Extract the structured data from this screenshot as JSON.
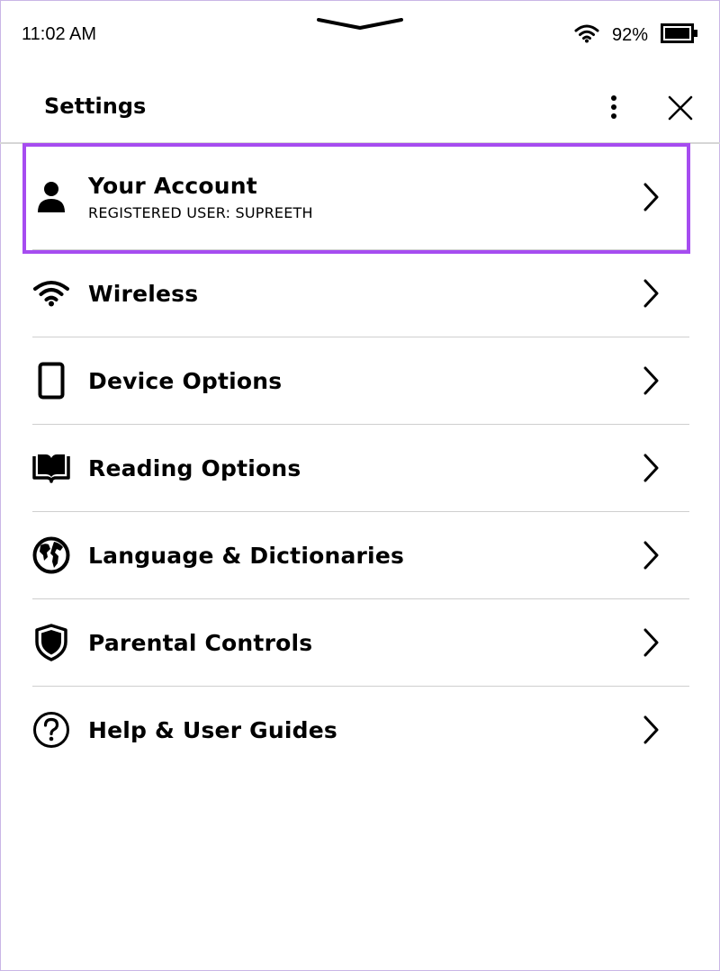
{
  "status_bar": {
    "time": "11:02 AM",
    "battery": "92%",
    "icons": [
      "pull-down-handle-icon",
      "wifi-icon",
      "battery-icon"
    ]
  },
  "header": {
    "title": "Settings",
    "icons": [
      "more-options-icon",
      "close-icon"
    ]
  },
  "settings_items": [
    {
      "label": "Your Account",
      "sub": "REGISTERED USER: SUPREETH",
      "icon": "person-icon"
    },
    {
      "label": "Wireless",
      "icon": "wifi-icon"
    },
    {
      "label": "Device Options",
      "icon": "device-icon"
    },
    {
      "label": "Reading Options",
      "icon": "book-icon"
    },
    {
      "label": "Language & Dictionaries",
      "icon": "globe-icon"
    },
    {
      "label": "Parental Controls",
      "icon": "shield-icon"
    },
    {
      "label": "Help & User Guides",
      "icon": "help-icon"
    }
  ],
  "highlight_color": "#a64cf0"
}
